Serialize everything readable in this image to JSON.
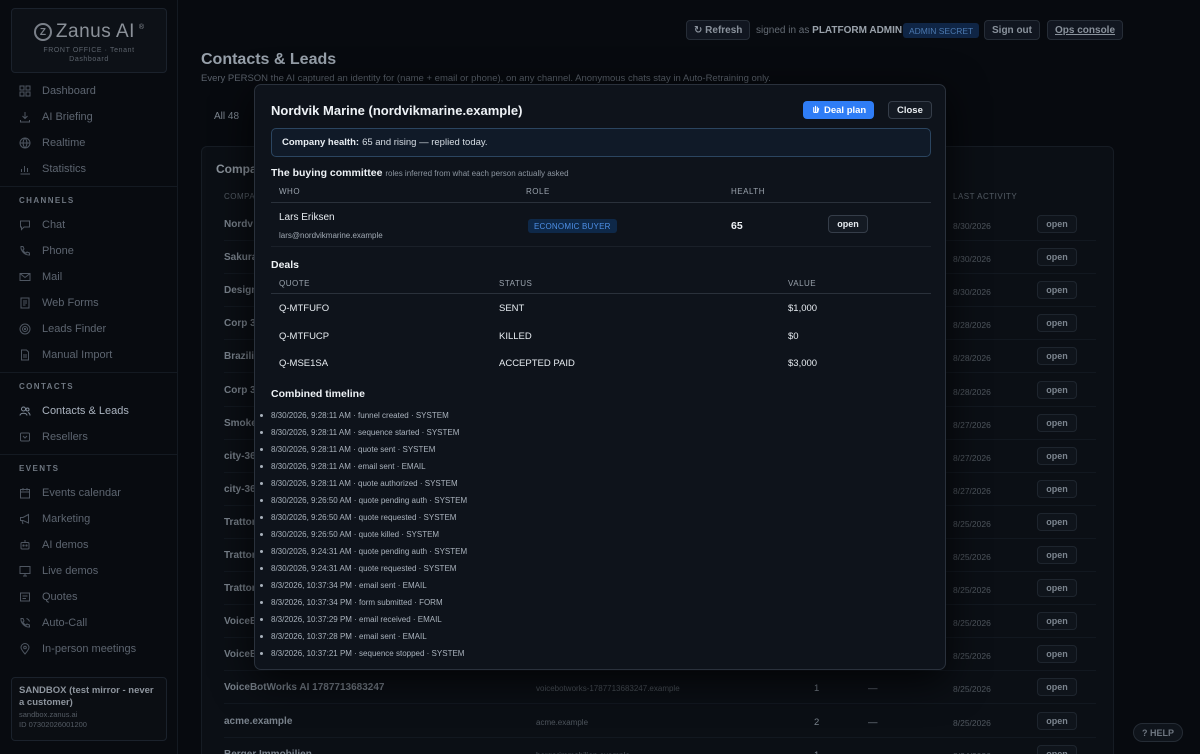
{
  "brand": {
    "name": "Zanus AI",
    "mark": "Z",
    "reg": "®",
    "sub1": "FRONT OFFICE · Tenant",
    "sub2": "Dashboard"
  },
  "sidebar": {
    "top_items": [
      {
        "label": "Dashboard",
        "icon": "grid-icon"
      },
      {
        "label": "AI Briefing",
        "icon": "download-icon"
      },
      {
        "label": "Realtime",
        "icon": "globe-icon"
      },
      {
        "label": "Statistics",
        "icon": "bar-chart-icon"
      }
    ],
    "sections": [
      {
        "title": "CHANNELS",
        "items": [
          {
            "label": "Chat",
            "icon": "chat-icon"
          },
          {
            "label": "Phone",
            "icon": "phone-icon"
          },
          {
            "label": "Mail",
            "icon": "mail-icon"
          },
          {
            "label": "Web Forms",
            "icon": "form-icon"
          },
          {
            "label": "Leads Finder",
            "icon": "target-icon"
          },
          {
            "label": "Manual Import",
            "icon": "file-icon"
          }
        ]
      },
      {
        "title": "CONTACTS",
        "items": [
          {
            "label": "Contacts & Leads",
            "icon": "users-icon",
            "active": true
          },
          {
            "label": "Resellers",
            "icon": "reseller-icon"
          }
        ]
      },
      {
        "title": "EVENTS",
        "items": [
          {
            "label": "Events calendar",
            "icon": "calendar-icon"
          },
          {
            "label": "Marketing",
            "icon": "megaphone-icon"
          },
          {
            "label": "AI demos",
            "icon": "robot-icon"
          },
          {
            "label": "Live demos",
            "icon": "screen-icon"
          },
          {
            "label": "Quotes",
            "icon": "quote-icon"
          },
          {
            "label": "Auto-Call",
            "icon": "phone-call-icon"
          },
          {
            "label": "In-person meetings",
            "icon": "pin-icon"
          }
        ]
      }
    ],
    "sandbox": {
      "title": "SANDBOX (test mirror - never a customer)",
      "host": "sandbox.zanus.ai",
      "id": "ID 07302026001200"
    }
  },
  "topbar": {
    "refresh": "↻ Refresh",
    "signed_in_prefix": "signed in as",
    "role": "PLATFORM ADMIN",
    "badge": "ADMIN SECRET",
    "sign_out": "Sign out",
    "ops_console": "Ops console"
  },
  "page": {
    "title": "Contacts & Leads",
    "description": "Every PERSON the AI captured an identity for (name + email or phone), on any channel. Anonymous chats stay in Auto-Retraining only.",
    "tab_all": "All 48",
    "card_title": "Compa",
    "columns": {
      "company": "COMPA",
      "last_activity": "LAST ACTIVITY"
    },
    "rows": [
      {
        "name": "Nordv",
        "domain": "",
        "num": "",
        "dash": "",
        "date": "8/30/2026",
        "open": "open"
      },
      {
        "name": "Sakura",
        "domain": "",
        "num": "",
        "dash": "",
        "date": "8/30/2026",
        "open": "open"
      },
      {
        "name": "Design",
        "domain": "",
        "num": "",
        "dash": "",
        "date": "8/30/2026",
        "open": "open"
      },
      {
        "name": "Corp 3",
        "domain": "",
        "num": "",
        "dash": "",
        "date": "8/28/2026",
        "open": "open"
      },
      {
        "name": "Brazilia",
        "domain": "",
        "num": "",
        "dash": "",
        "date": "8/28/2026",
        "open": "open"
      },
      {
        "name": "Corp 3",
        "domain": "",
        "num": "",
        "dash": "",
        "date": "8/28/2026",
        "open": "open"
      },
      {
        "name": "Smoke",
        "domain": "",
        "num": "",
        "dash": "",
        "date": "8/27/2026",
        "open": "open"
      },
      {
        "name": "city-36",
        "domain": "",
        "num": "",
        "dash": "",
        "date": "8/27/2026",
        "open": "open"
      },
      {
        "name": "city-36",
        "domain": "",
        "num": "",
        "dash": "",
        "date": "8/27/2026",
        "open": "open"
      },
      {
        "name": "Trattor",
        "domain": "",
        "num": "",
        "dash": "",
        "date": "8/25/2026",
        "open": "open"
      },
      {
        "name": "Trattor",
        "domain": "",
        "num": "",
        "dash": "",
        "date": "8/25/2026",
        "open": "open"
      },
      {
        "name": "Trattor",
        "domain": "",
        "num": "",
        "dash": "",
        "date": "8/25/2026",
        "open": "open"
      },
      {
        "name": "VoiceB",
        "domain": "",
        "num": "",
        "dash": "",
        "date": "8/25/2026",
        "open": "open"
      },
      {
        "name": "VoiceB",
        "domain": "",
        "num": "",
        "dash": "",
        "date": "8/25/2026",
        "open": "open"
      },
      {
        "name": "VoiceBotWorks AI 1787713683247",
        "domain": "voicebotworks-1787713683247.example",
        "num": "1",
        "dash": "—",
        "date": "8/25/2026",
        "open": "open"
      },
      {
        "name": "acme.example",
        "domain": "acme.example",
        "num": "2",
        "dash": "—",
        "date": "8/25/2026",
        "open": "open"
      },
      {
        "name": "Berger Immobilien",
        "domain": "bergerimmobilien.example",
        "num": "1",
        "dash": "",
        "date": "8/24/2026",
        "open": "open"
      }
    ],
    "help": "? HELP"
  },
  "modal": {
    "title": "Nordvik Marine (nordvikmarine.example)",
    "deal_plan": "Deal plan",
    "close": "Close",
    "health_label": "Company health:",
    "health_text": "65 and rising — replied today.",
    "committee": {
      "title": "The buying committee",
      "subtitle": "roles inferred from what each person actually asked",
      "headers": {
        "who": "WHO",
        "role": "ROLE",
        "health": "HEALTH"
      },
      "person": {
        "name": "Lars Eriksen",
        "email": "lars@nordvikmarine.example",
        "role": "ECONOMIC BUYER",
        "health": "65",
        "open": "open"
      }
    },
    "deals": {
      "title": "Deals",
      "headers": {
        "quote": "QUOTE",
        "status": "STATUS",
        "value": "VALUE"
      },
      "rows": [
        {
          "quote": "Q-MTFUFO",
          "status": "SENT",
          "value": "$1,000"
        },
        {
          "quote": "Q-MTFUCP",
          "status": "KILLED",
          "value": "$0"
        },
        {
          "quote": "Q-MSE1SA",
          "status": "ACCEPTED PAID",
          "value": "$3,000"
        }
      ]
    },
    "timeline": {
      "title": "Combined timeline",
      "items": [
        "8/30/2026, 9:28:11 AM · funnel created · SYSTEM",
        "8/30/2026, 9:28:11 AM · sequence started · SYSTEM",
        "8/30/2026, 9:28:11 AM · quote sent · SYSTEM",
        "8/30/2026, 9:28:11 AM · email sent · EMAIL",
        "8/30/2026, 9:28:11 AM · quote authorized · SYSTEM",
        "8/30/2026, 9:26:50 AM · quote pending auth · SYSTEM",
        "8/30/2026, 9:26:50 AM · quote requested · SYSTEM",
        "8/30/2026, 9:26:50 AM · quote killed · SYSTEM",
        "8/30/2026, 9:24:31 AM · quote pending auth · SYSTEM",
        "8/30/2026, 9:24:31 AM · quote requested · SYSTEM",
        "8/3/2026, 10:37:34 PM · email sent · EMAIL",
        "8/3/2026, 10:37:34 PM · form submitted · FORM",
        "8/3/2026, 10:37:29 PM · email received · EMAIL",
        "8/3/2026, 10:37:28 PM · email sent · EMAIL",
        "8/3/2026, 10:37:21 PM · sequence stopped · SYSTEM"
      ]
    }
  }
}
